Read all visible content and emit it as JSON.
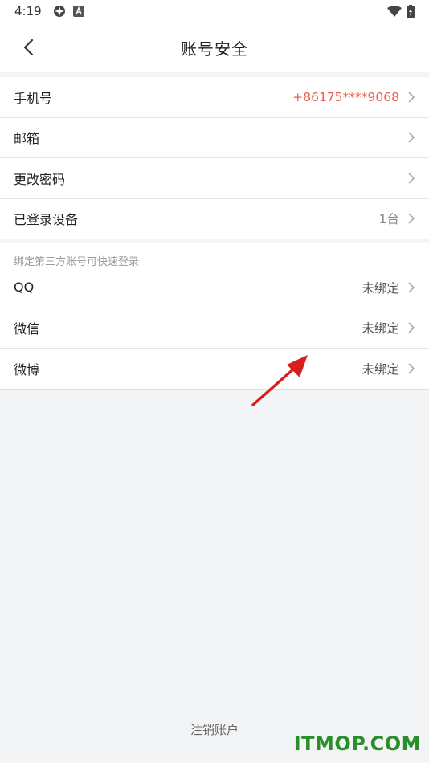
{
  "status_bar": {
    "time": "4:19"
  },
  "nav": {
    "title": "账号安全"
  },
  "account_group": {
    "items": [
      {
        "label": "手机号",
        "value": "+86175****9068"
      },
      {
        "label": "邮箱",
        "value": ""
      },
      {
        "label": "更改密码",
        "value": ""
      },
      {
        "label": "已登录设备",
        "value": "1台"
      }
    ]
  },
  "binding_group": {
    "hint": "绑定第三方账号可快速登录",
    "items": [
      {
        "label": "QQ",
        "value": "未绑定"
      },
      {
        "label": "微信",
        "value": "未绑定"
      },
      {
        "label": "微博",
        "value": "未绑定"
      }
    ]
  },
  "footer": {
    "cancel_account": "注销账户"
  },
  "watermark": "ITMOP.COM",
  "colors": {
    "phone_value": "#e8604c",
    "background": "#f2f4f5",
    "annotation_arrow": "#d81e1e",
    "watermark": "#2a8f2a"
  }
}
